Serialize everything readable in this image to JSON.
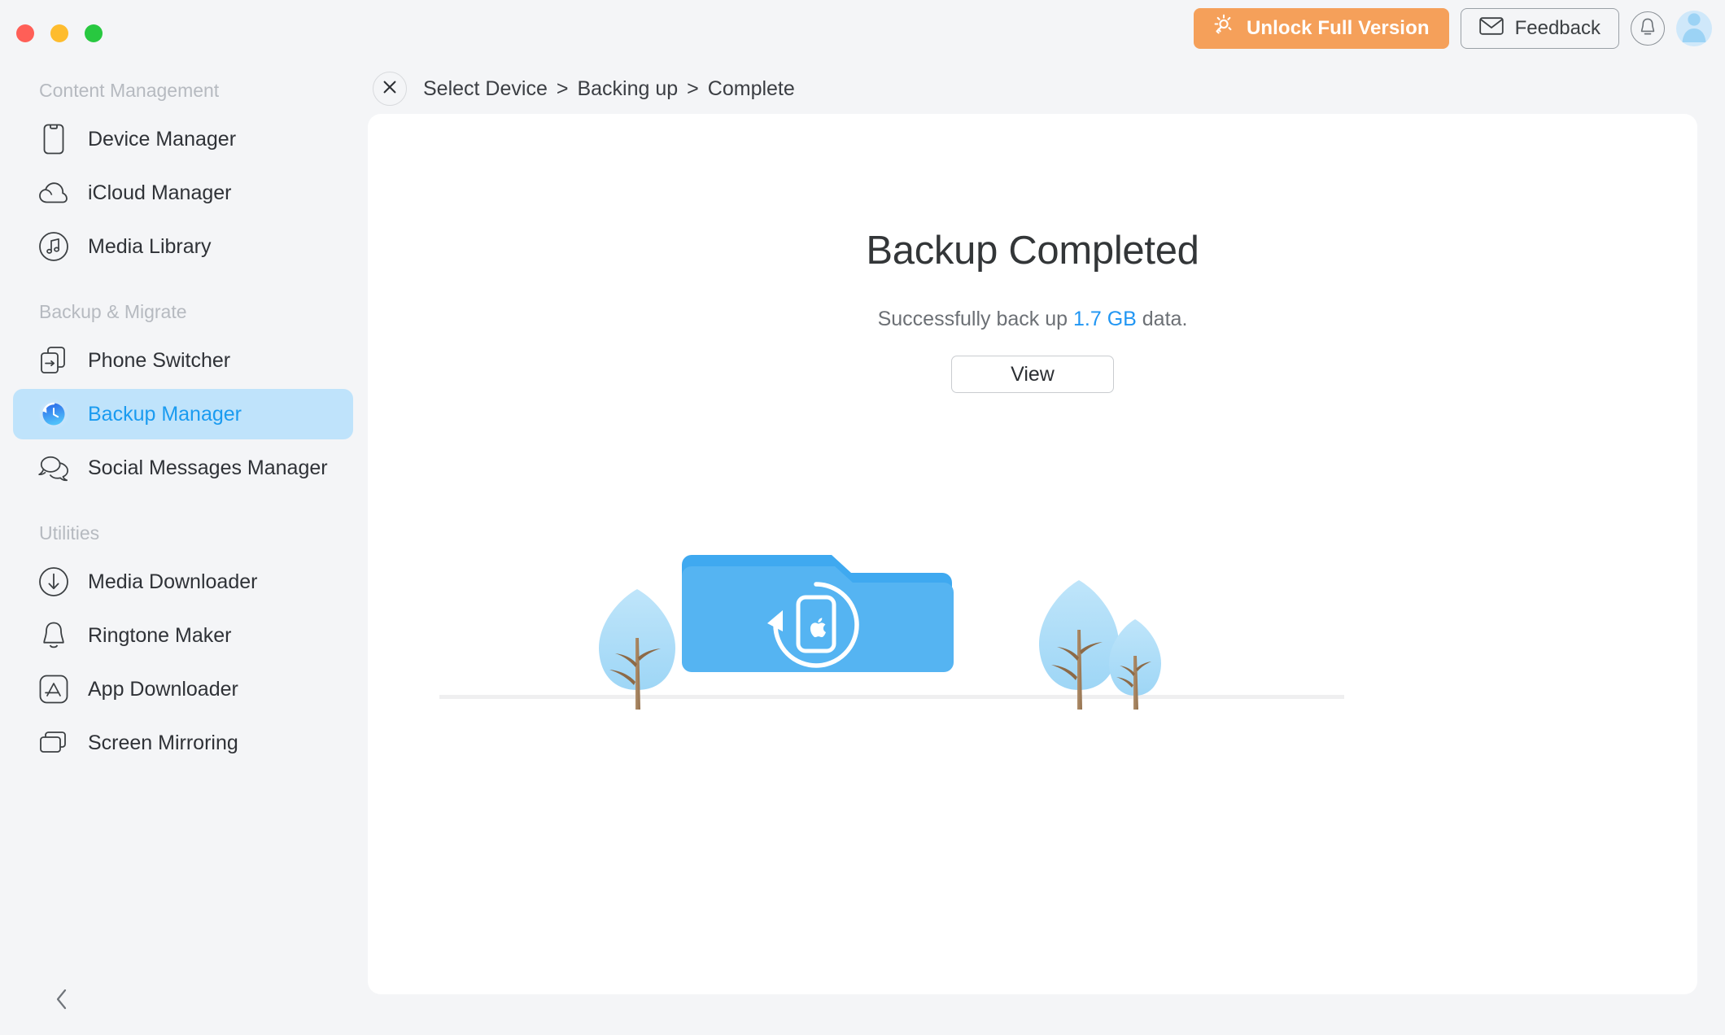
{
  "window": {
    "traffic_lights": [
      "close",
      "minimize",
      "zoom"
    ]
  },
  "topbar": {
    "unlock_label": "Unlock Full Version",
    "unlock_icon": "key-light-icon",
    "unlock_color": "#f5a05a",
    "feedback_label": "Feedback",
    "feedback_icon": "envelope-icon",
    "notification_icon": "bell-icon",
    "avatar_icon": "user-avatar-icon"
  },
  "sidebar": {
    "sections": [
      {
        "title": "Content Management",
        "items": [
          {
            "label": "Device Manager",
            "icon": "phone-outline-icon",
            "active": false
          },
          {
            "label": "iCloud Manager",
            "icon": "cloud-icon",
            "active": false
          },
          {
            "label": "Media Library",
            "icon": "music-note-circle-icon",
            "active": false
          }
        ]
      },
      {
        "title": "Backup & Migrate",
        "items": [
          {
            "label": "Phone Switcher",
            "icon": "phone-transfer-icon",
            "active": false
          },
          {
            "label": "Backup Manager",
            "icon": "clock-restore-icon",
            "active": true
          },
          {
            "label": "Social Messages Manager",
            "icon": "chat-bubbles-icon",
            "active": false
          }
        ]
      },
      {
        "title": "Utilities",
        "items": [
          {
            "label": "Media Downloader",
            "icon": "download-circle-icon",
            "active": false
          },
          {
            "label": "Ringtone Maker",
            "icon": "bell-outline-icon",
            "active": false
          },
          {
            "label": "App Downloader",
            "icon": "appstore-icon",
            "active": false
          },
          {
            "label": "Screen Mirroring",
            "icon": "screens-stack-icon",
            "active": false
          }
        ]
      }
    ],
    "collapse_icon": "chevron-left-icon",
    "active_bg": "#bfe3fb",
    "active_text": "#1a9bf0"
  },
  "breadcrumb": {
    "close_icon": "close-x-icon",
    "steps": [
      "Select Device",
      "Backing up",
      "Complete"
    ],
    "separator": ">"
  },
  "main": {
    "title": "Backup Completed",
    "subtitle_prefix": "Successfully back up",
    "subtitle_size": "1.7 GB",
    "subtitle_suffix": "data.",
    "view_button": "View",
    "highlight_color": "#2196f3",
    "illustration": {
      "name": "backup-folder-illustration",
      "folder_color": "#55b4f2",
      "tree_color": "#a8dcf7",
      "trunk_color": "#a5815b",
      "ground_color": "#f0f0f0",
      "device_icon": "iphone-apple-restore-icon"
    }
  }
}
